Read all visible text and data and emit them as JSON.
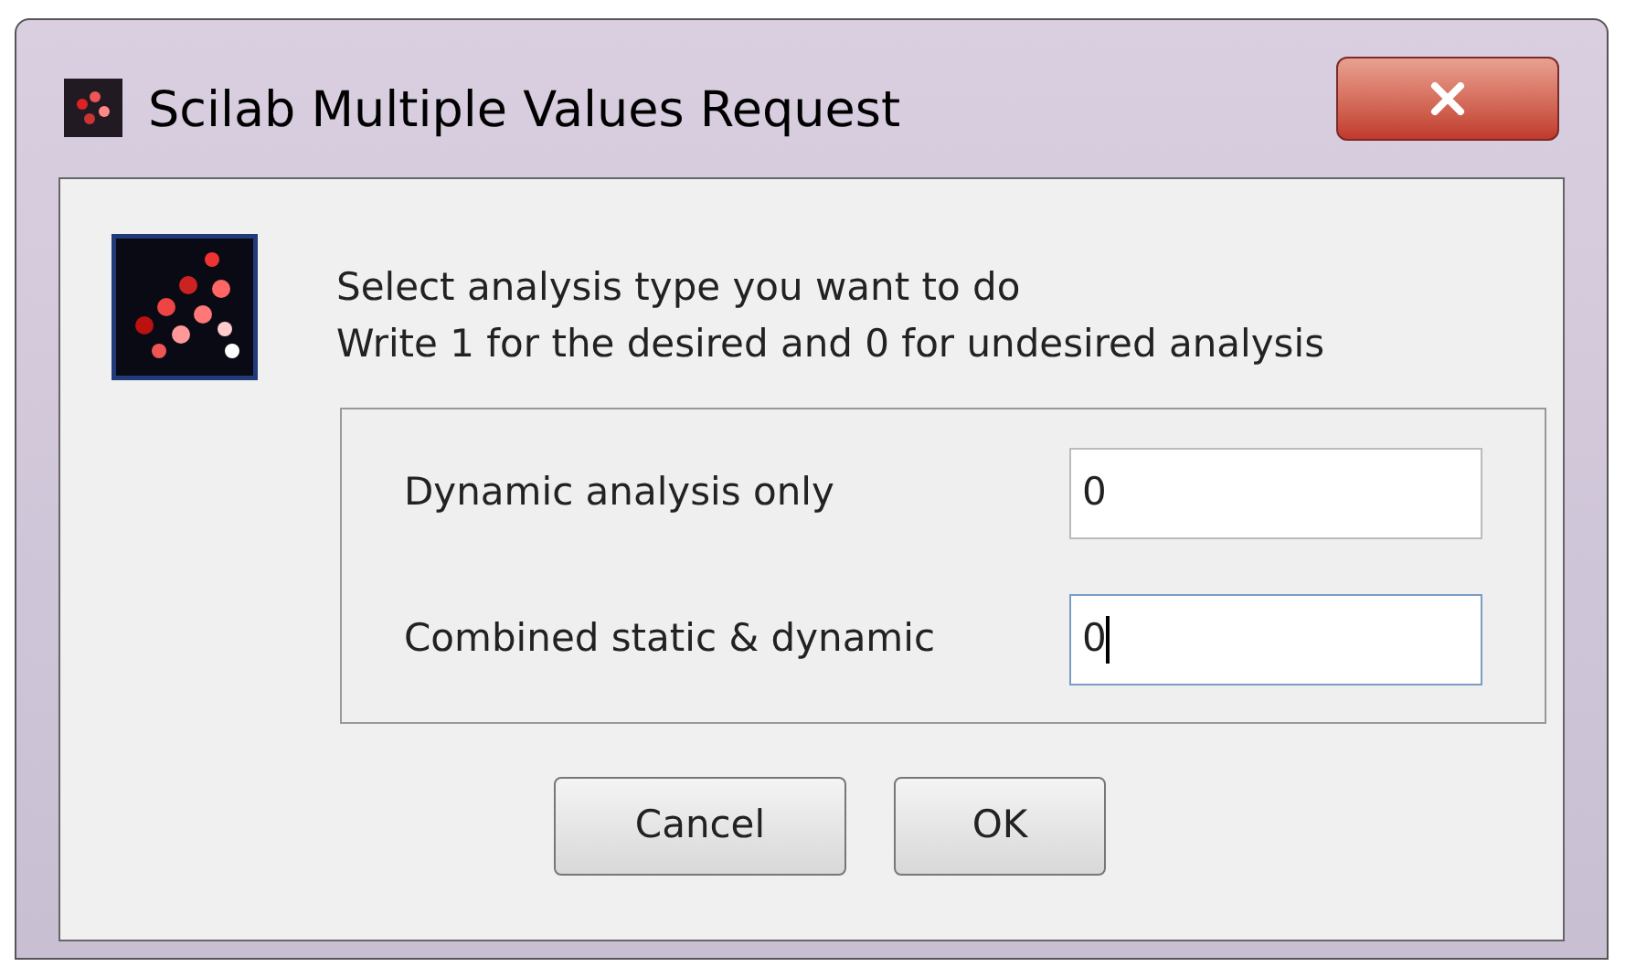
{
  "window": {
    "title": "Scilab Multiple Values Request"
  },
  "message": [
    "Select analysis type you want to do",
    "Write 1 for the desired and 0 for undesired analysis"
  ],
  "fields": [
    {
      "label": "Dynamic analysis only",
      "value": "0",
      "focused": false
    },
    {
      "label": "Combined static & dynamic",
      "value": "0",
      "focused": true
    }
  ],
  "buttons": [
    "Cancel",
    "OK"
  ]
}
